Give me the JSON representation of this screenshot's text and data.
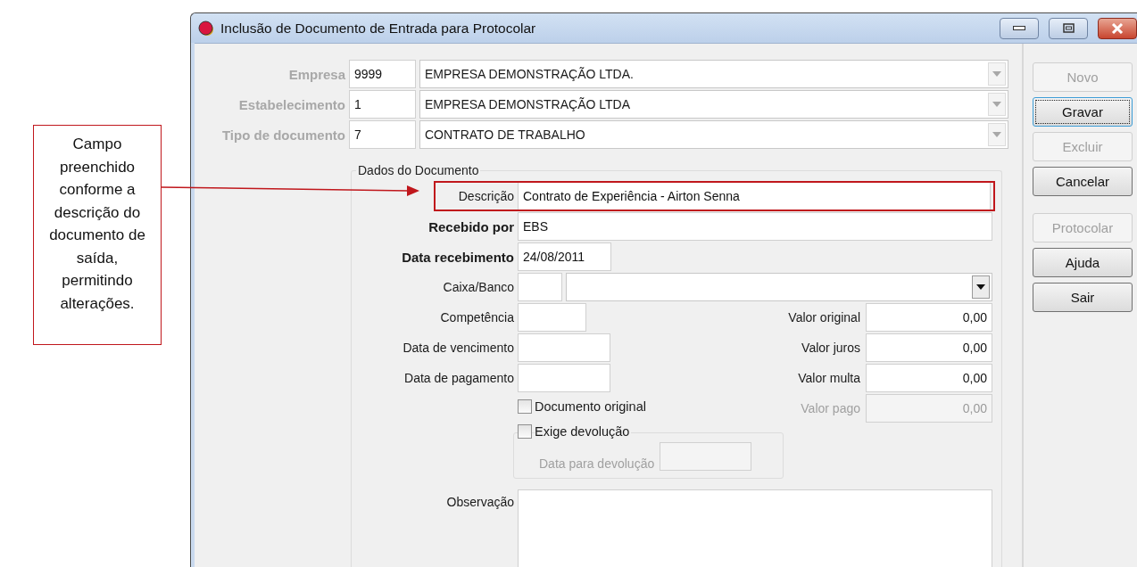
{
  "window": {
    "title": "Inclusão de Documento de Entrada para Protocolar"
  },
  "callout": {
    "text": "Campo preenchido conforme a descrição do documento de saída, permitindo alterações."
  },
  "header_rows": [
    {
      "label": "Empresa",
      "code": "9999",
      "name": "EMPRESA DEMONSTRAÇÃO LTDA.",
      "disabled": true
    },
    {
      "label": "Estabelecimento",
      "code": "1",
      "name": "EMPRESA DEMONSTRAÇÃO LTDA",
      "disabled": true
    },
    {
      "label": "Tipo de documento",
      "code": "7",
      "name": "CONTRATO DE TRABALHO",
      "disabled": true
    }
  ],
  "document": {
    "title": "Dados do Documento",
    "description": {
      "label": "Descrição",
      "value": "Contrato de Experiência - Airton Senna",
      "highlighted": true
    },
    "received_by": {
      "label": "Recebido por",
      "value": "EBS",
      "required": true
    },
    "received_date": {
      "label": "Data recebimento",
      "value": "24/08/2011",
      "required": true
    },
    "cash_bank": {
      "label": "Caixa/Banco"
    },
    "date_fields": [
      {
        "label": "Competência",
        "kind": "short"
      },
      {
        "label": "Data de vencimento",
        "kind": "date"
      },
      {
        "label": "Data de pagamento",
        "kind": "date"
      }
    ],
    "amounts": [
      {
        "label": "Valor original",
        "value": "0,00",
        "disabled": false
      },
      {
        "label": "Valor juros",
        "value": "0,00",
        "disabled": false
      },
      {
        "label": "Valor multa",
        "value": "0,00",
        "disabled": false
      },
      {
        "label": "Valor pago",
        "value": "0,00",
        "disabled": true
      }
    ],
    "original_document": {
      "label": "Documento original",
      "checked": false
    },
    "return_required": {
      "label": "Exige devolução",
      "checked": false,
      "date_label": "Data para devolução",
      "date_disabled": true
    },
    "notes": {
      "label": "Observação"
    }
  },
  "buttons": [
    {
      "label": "Novo",
      "disabled": true,
      "focused": false
    },
    {
      "label": "Gravar",
      "disabled": false,
      "focused": true
    },
    {
      "label": "Excluir",
      "disabled": true,
      "focused": false
    },
    {
      "label": "Cancelar",
      "disabled": false,
      "focused": false
    },
    {
      "label": "Protocolar",
      "disabled": true,
      "focused": false
    },
    {
      "label": "Ajuda",
      "disabled": false,
      "focused": false
    },
    {
      "label": "Sair",
      "disabled": false,
      "focused": false
    }
  ]
}
